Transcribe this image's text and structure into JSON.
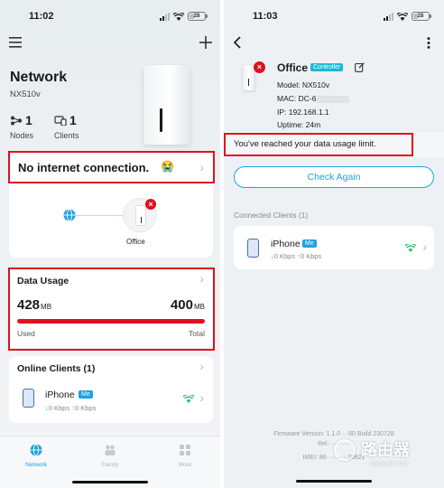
{
  "left": {
    "status": {
      "time": "11:02",
      "battery": "28"
    },
    "header": {
      "title": "Network",
      "model": "NX510v"
    },
    "stats": [
      {
        "icon": "nodes-icon",
        "value": "1",
        "label": "Nodes"
      },
      {
        "icon": "clients-icon",
        "value": "1",
        "label": "Clients"
      }
    ],
    "alert": {
      "text": "No internet connection.",
      "emoji": "😭"
    },
    "topology": {
      "node_label": "Office"
    },
    "data_usage": {
      "title": "Data Usage",
      "used_value": "428",
      "used_unit": "MB",
      "total_value": "400",
      "total_unit": "MB",
      "used_label": "Used",
      "total_label": "Total",
      "fill": 1.0,
      "bar_color": "#e0101e"
    },
    "online_clients": {
      "title": "Online Clients (1)",
      "client": {
        "name": "iPhone",
        "badge": "Me",
        "down": "0 Kbps",
        "up": "0 Kbps"
      }
    },
    "tabbar": [
      {
        "label": "Network",
        "icon": "network-globe-icon",
        "active": true
      },
      {
        "label": "Family",
        "icon": "family-icon",
        "active": false
      },
      {
        "label": "More",
        "icon": "grid-icon",
        "active": false
      }
    ]
  },
  "right": {
    "status": {
      "time": "11:03",
      "battery": "28"
    },
    "device": {
      "name": "Office",
      "role_badge": "Controller",
      "model": "Model: NX510v",
      "mac": "MAC: DC-6",
      "ip": "IP: 192.168.1.1",
      "uptime": "Uptime: 24m"
    },
    "limit_message": "You've reached your data usage limit.",
    "check_again": "Check Again",
    "connected_title": "Connected Clients (1)",
    "client": {
      "name": "iPhone",
      "badge": "Me",
      "down": "0 Kbps",
      "up": "0 Kbps"
    },
    "footer": {
      "firmware": "Firmware Version: 1.1.0 ···60  Build 230728",
      "rel": "Rel.··········",
      "imei": "IMEI: 86··········30821"
    }
  },
  "watermark": {
    "brand": "路由器",
    "site": "luyouqi.com"
  },
  "colors": {
    "accent": "#1fa1e0",
    "alert_red": "#e0101e",
    "wifi_green": "#21c06b",
    "down_green": "#21c06b",
    "up_orange": "#f5a623"
  }
}
